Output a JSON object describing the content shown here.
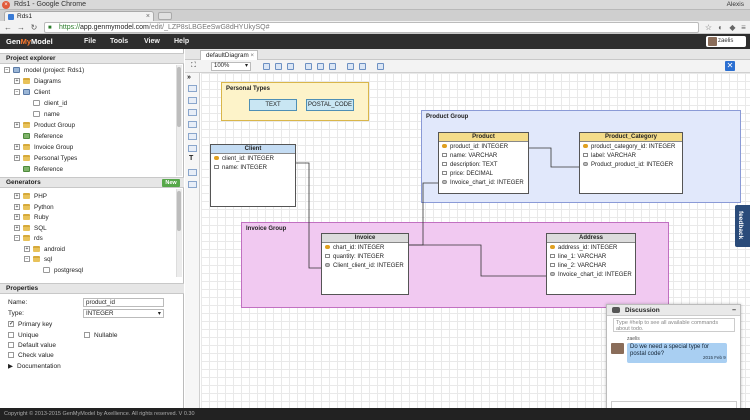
{
  "window": {
    "title": "Rds1 - Google Chrome",
    "user": "Alexis",
    "tab_title": "Rds1",
    "close_glyph": "×"
  },
  "browser": {
    "url_scheme": "https://",
    "url_host": "app.genmymodel.com",
    "url_path": "/edit/_LZP8sLBGEeSwG8dHYUkySQ#"
  },
  "app": {
    "logo_prefix": "Gen",
    "logo_accent": "My",
    "logo_suffix": "Model",
    "menu": [
      "File",
      "Tools",
      "View",
      "Help"
    ],
    "username": "zaelis"
  },
  "project_explorer": {
    "title": "Project explorer",
    "items": [
      {
        "label": "model (project: Rds1)",
        "icon": "model-icon",
        "expander": "⊟"
      },
      {
        "label": "Diagrams",
        "icon": "folder-icon",
        "expander": "⊞"
      },
      {
        "label": "Client",
        "icon": "class-icon",
        "expander": "⊟"
      },
      {
        "label": "client_id",
        "icon": "attribute-icon",
        "expander": ""
      },
      {
        "label": "name",
        "icon": "attribute-icon",
        "expander": ""
      },
      {
        "label": "Product Group",
        "icon": "package-icon",
        "expander": "⊞"
      },
      {
        "label": "Reference",
        "icon": "reference-icon",
        "expander": ""
      },
      {
        "label": "Invoice Group",
        "icon": "package-icon",
        "expander": "⊞"
      },
      {
        "label": "Personal Types",
        "icon": "package-icon",
        "expander": "⊞"
      },
      {
        "label": "Reference",
        "icon": "reference-icon",
        "expander": ""
      }
    ]
  },
  "generators": {
    "title": "Generators",
    "new_label": "New",
    "items": [
      {
        "label": "PHP",
        "expander": "⊞"
      },
      {
        "label": "Python",
        "expander": "⊞"
      },
      {
        "label": "Ruby",
        "expander": "⊞"
      },
      {
        "label": "SQL",
        "expander": "⊞"
      },
      {
        "label": "rds",
        "expander": "⊟"
      },
      {
        "label": "android",
        "expander": "⊞"
      },
      {
        "label": "sql",
        "expander": "⊟"
      },
      {
        "label": "postgresql",
        "expander": ""
      }
    ]
  },
  "properties": {
    "title": "Properties",
    "name_label": "Name:",
    "name_value": "product_id",
    "type_label": "Type:",
    "type_value": "INTEGER",
    "primary_key": "Primary key",
    "unique": "Unique",
    "nullable": "Nullable",
    "default_value": "Default value",
    "check_value": "Check value",
    "documentation": "Documentation"
  },
  "editor": {
    "tab_label": "defaultDiagram",
    "zoom": "100%",
    "close_glyph": "✕"
  },
  "diagram": {
    "personal_types": {
      "title": "Personal Types",
      "types": [
        "TEXT",
        "POSTAL_CODE"
      ]
    },
    "product_group": {
      "title": "Product Group"
    },
    "invoice_group": {
      "title": "Invoice Group"
    },
    "client": {
      "name": "Client",
      "rows": [
        "client_id: INTEGER",
        "name: INTEGER"
      ]
    },
    "product": {
      "name": "Product",
      "rows": [
        "product_id: INTEGER",
        "name: VARCHAR",
        "description: TEXT",
        "price: DECIMAL",
        "Invoice_chart_id: INTEGER"
      ]
    },
    "product_category": {
      "name": "Product_Category",
      "rows": [
        "product_category_id: INTEGER",
        "label: VARCHAR",
        "Product_product_id: INTEGER"
      ]
    },
    "invoice": {
      "name": "Invoice",
      "rows": [
        "chart_id: INTEGER",
        "quantity: INTEGER",
        "Client_client_id: INTEGER"
      ]
    },
    "address": {
      "name": "Address",
      "rows": [
        "address_id: INTEGER",
        "line_1: VARCHAR",
        "line_2: VARCHAR",
        "Invoice_chart_id: INTEGER"
      ]
    }
  },
  "discussion": {
    "title": "Discussion",
    "help_text": "Type #help to see all available commands about todo.",
    "author": "zaelis",
    "message": "Do we need a special type for postal code?",
    "timestamp": "2015 Feb 9"
  },
  "feedback_label": "feedback",
  "footer": "Copyright © 2013-2015 GenMyModel by Axellience. All rights reserved. V 0.30"
}
